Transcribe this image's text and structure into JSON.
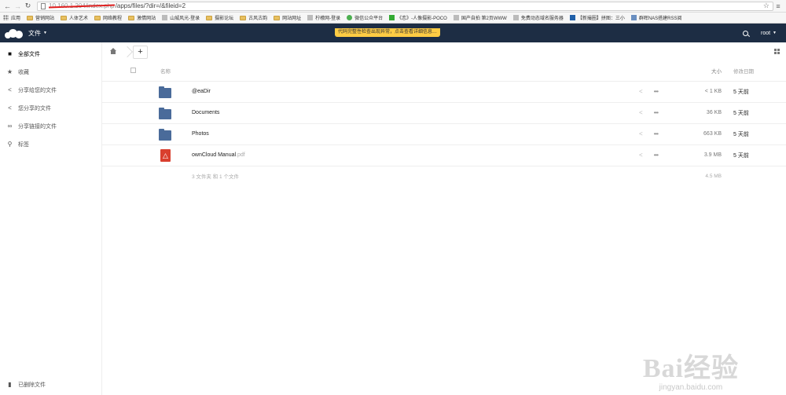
{
  "browser": {
    "url_host": "10.160.1.204/index.php",
    "url_path": "/apps/files/?dir=/&fileid=2"
  },
  "bookmarks": [
    "应用",
    "营销网站",
    "人体艺术",
    "网络教程",
    "激情网站",
    "山城风光-登录",
    "摄影论坛",
    "古风古韵",
    "网站网址",
    "柠檬网-登录",
    "微信公众平台",
    "《恋》-人像摄影-POCO",
    "国产自拍 第2页WWW",
    "免费动态域名服务器",
    "【新撮圈】拼图：三小",
    "群晖NAS搭建RSS阅"
  ],
  "header": {
    "app_name": "文件",
    "notification": "代码完整性检查出现异常，点击查看详细信息…",
    "user": "root"
  },
  "sidebar": {
    "items": [
      {
        "label": "全部文件",
        "icon": "folder-icon"
      },
      {
        "label": "收藏",
        "icon": "star-icon"
      },
      {
        "label": "分享给您的文件",
        "icon": "share-icon"
      },
      {
        "label": "您分享的文件",
        "icon": "share-icon"
      },
      {
        "label": "分享链接的文件",
        "icon": "link-icon"
      },
      {
        "label": "标签",
        "icon": "tag-icon"
      }
    ],
    "trash": "已删除文件"
  },
  "table": {
    "col_name": "名称",
    "col_size": "大小",
    "col_modified": "修改日期",
    "rows": [
      {
        "name": "@eaDir",
        "ext": "",
        "size": "< 1 KB",
        "modified": "5 天前"
      },
      {
        "name": "Documents",
        "ext": "",
        "size": "36 KB",
        "modified": "5 天前"
      },
      {
        "name": "Photos",
        "ext": "",
        "size": "663 KB",
        "modified": "5 天前"
      },
      {
        "name": "ownCloud Manual",
        "ext": ".pdf",
        "size": "3.9 MB",
        "modified": "5 天前"
      }
    ],
    "summary_text": "3 文件夹 和 1 个文件",
    "summary_size": "4.5 MB"
  },
  "watermark": {
    "brand": "Bai经验",
    "url": "jingyan.baidu.com"
  }
}
